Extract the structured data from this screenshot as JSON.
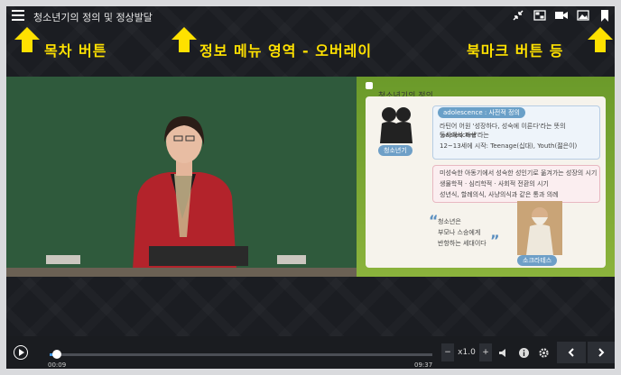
{
  "top": {
    "title": "청소년기의 정의 및 정상발달"
  },
  "overlay": {
    "toc_label": "목차 버튼",
    "info_label": "정보 메뉴 영역 - 오버레이",
    "bookmark_label": "북마크 버튼 등"
  },
  "slide": {
    "title": "청소년기의 정의",
    "tag": "adolescence : 사전적 정의",
    "line1": "라틴어 어원 '성장하다, 성숙에 이른다'라는 뜻의 'adolescere'라는",
    "line2": "동사에서 파생",
    "line3": "12~13세에 시작: Teenage(십대), Youth(젊은이)",
    "box_label": "청소년기",
    "line4": "미성숙한 아동기에서 성숙한 성인기로 옮겨가는 성장의 시기",
    "line5": "생물학적 · 심리학적 · 사회적 전환의 시기",
    "line6": "성년식, 할례의식, 사냥의식과 같은 통과 의례",
    "quote1": "청소년은",
    "quote2": "부모나 스승에게",
    "quote3": "반항하는 세대이다",
    "socrates": "소크라테스"
  },
  "player": {
    "current_time": "00:09",
    "total_time": "09:37",
    "speed": "x1.0",
    "progress": 0.02
  }
}
